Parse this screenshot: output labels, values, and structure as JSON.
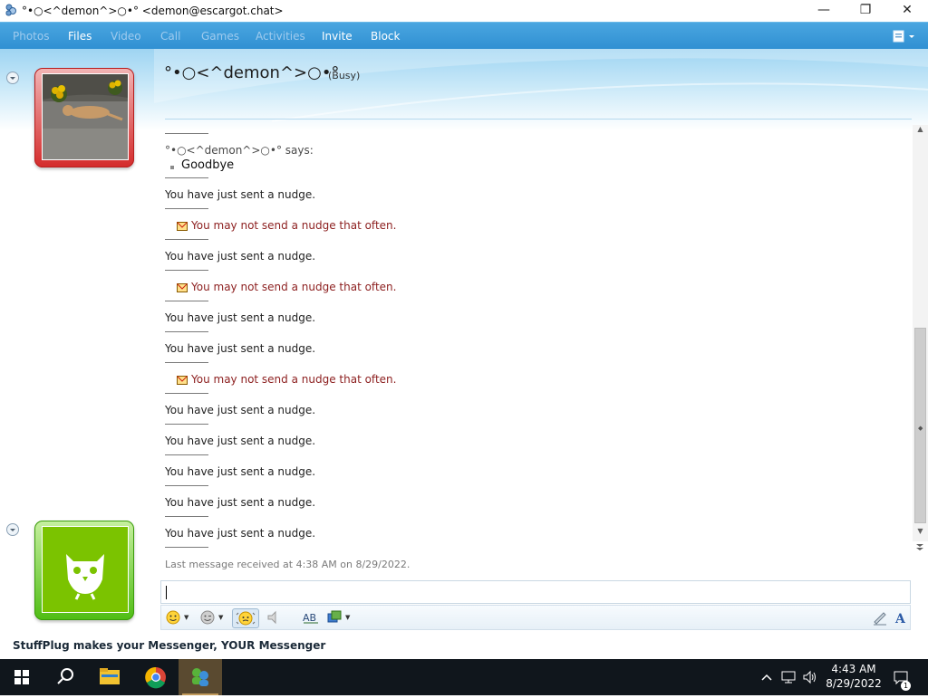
{
  "window": {
    "title": "°•○<^demon^>○•° <demon@escargot.chat>",
    "minimize": "—",
    "maximize": "❐",
    "close": "✕"
  },
  "menu": {
    "items": [
      {
        "label": "Photos",
        "enabled": false
      },
      {
        "label": "Files",
        "enabled": true
      },
      {
        "label": "Video",
        "enabled": false
      },
      {
        "label": "Call",
        "enabled": false
      },
      {
        "label": "Games",
        "enabled": false
      },
      {
        "label": "Activities",
        "enabled": false
      },
      {
        "label": "Invite",
        "enabled": true
      },
      {
        "label": "Block",
        "enabled": true
      }
    ]
  },
  "contact": {
    "name": "°•○<^demon^>○•°",
    "status": "(Busy)",
    "status_color": "#d42b2b"
  },
  "self": {
    "status_color": "#4fbd13"
  },
  "conversation": {
    "says_header": "°•○<^demon^>○•° says:",
    "message": "Goodbye",
    "nudge_sent": "You have just sent a nudge.",
    "nudge_warning": "You may not send a nudge that often.",
    "entries": [
      "sent",
      "warn",
      "sent",
      "warn",
      "sent",
      "sent",
      "warn",
      "sent",
      "sent",
      "sent",
      "sent",
      "sent"
    ],
    "last_message": "Last message received at 4:38 AM on 8/29/2022."
  },
  "input": {
    "value": ""
  },
  "footer": {
    "text": "StuffPlug makes your Messenger, YOUR Messenger"
  },
  "taskbar": {
    "time": "4:43 AM",
    "date": "8/29/2022",
    "notifications": "1"
  }
}
